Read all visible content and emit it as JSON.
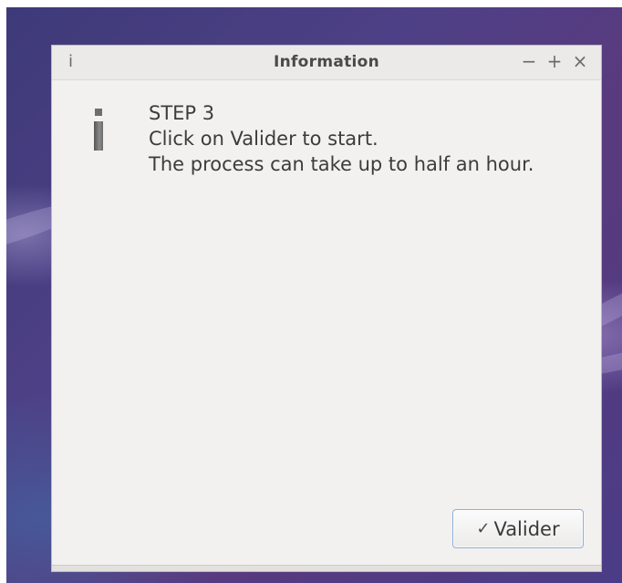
{
  "window": {
    "title": "Information",
    "title_icon": "i",
    "controls": {
      "minimize": "−",
      "maximize": "+",
      "close": "×"
    }
  },
  "dialog": {
    "icon": "information-icon",
    "lines": [
      "STEP 3",
      "Click on Valider to start.",
      "The process can take up to half an hour."
    ]
  },
  "buttons": {
    "valider": {
      "check": "✓",
      "label": "Valider"
    }
  },
  "colors": {
    "window_bg": "#f2f1f0",
    "titlebar_bg": "#ebeae8",
    "button_border": "#8fb0d8",
    "desktop": "#4e4086"
  }
}
